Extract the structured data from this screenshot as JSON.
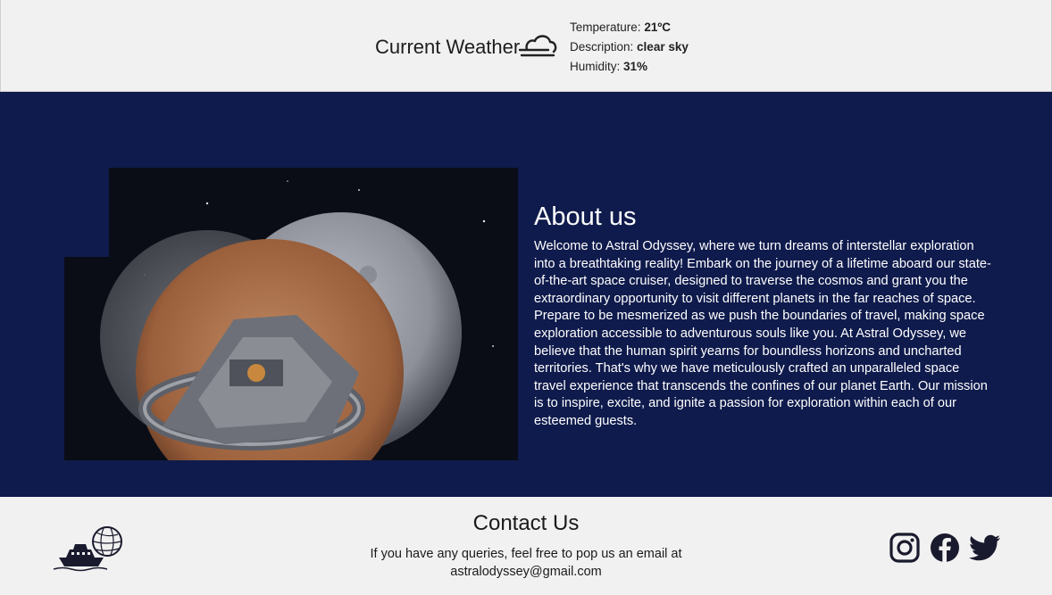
{
  "weather": {
    "title": "Current Weather",
    "icon": "cloud-wind-icon",
    "temperature_label": "Temperature:",
    "temperature_value": "21ºC",
    "description_label": "Description:",
    "description_value": "clear sky",
    "humidity_label": "Humidity:",
    "humidity_value": "31%"
  },
  "about": {
    "title": "About us",
    "image": "spaceship-planets-image",
    "text": "Welcome to Astral Odyssey, where we turn dreams of interstellar exploration into a breathtaking reality! Embark on the journey of a lifetime aboard our state-of-the-art space cruiser, designed to traverse the cosmos and grant you the extraordinary opportunity to visit different planets in the far reaches of space. Prepare to be mesmerized as we push the boundaries of travel, making space exploration accessible to adventurous souls like you. At Astral Odyssey, we believe that the human spirit yearns for boundless horizons and uncharted territories. That's why we have meticulously crafted an unparalleled space travel experience that transcends the confines of our planet Earth. Our mission is to inspire, excite, and ignite a passion for exploration within each of our esteemed guests."
  },
  "contact": {
    "title": "Contact Us",
    "text": "If you have any queries, feel free to pop us an email at astralodyssey@gmail.com",
    "logo": "ship-logo-icon",
    "social": [
      "instagram-icon",
      "facebook-icon",
      "twitter-icon"
    ]
  },
  "colors": {
    "navy": "#0f1b4c",
    "light": "#f1f1f1",
    "text_dark": "#1a1a1a",
    "icon_color": "#1a1a2e"
  }
}
